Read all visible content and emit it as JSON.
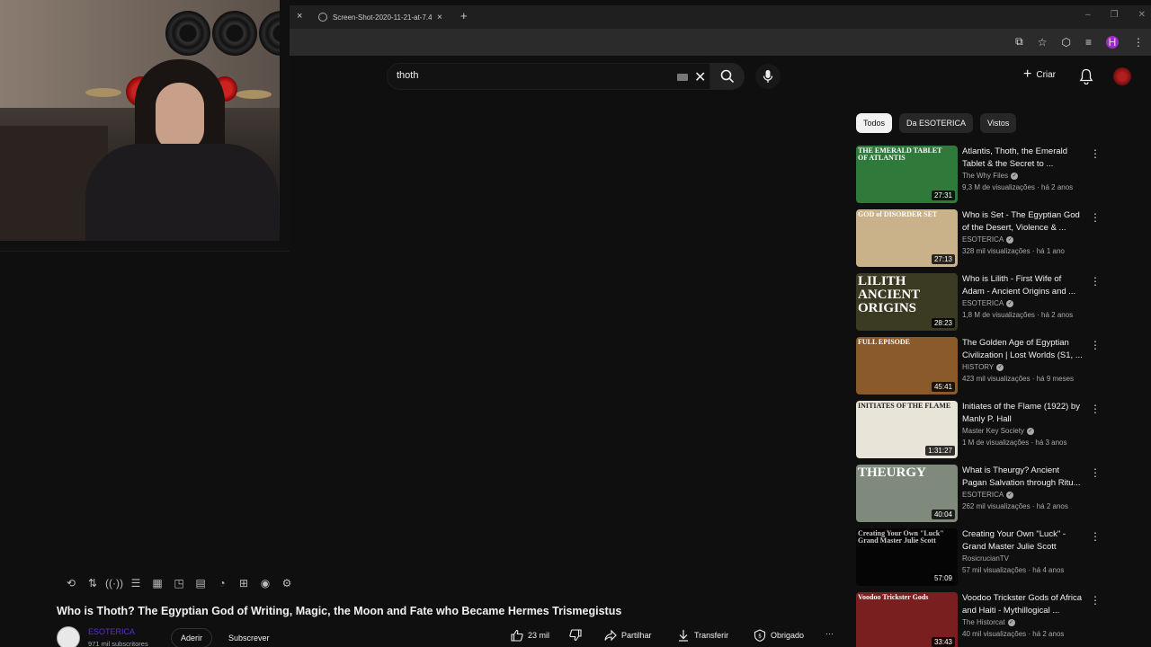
{
  "browser": {
    "tab_title": "Screen-Shot-2020-11-21-at-7.4",
    "new_tab": "+",
    "tab_close": "×",
    "prev_tab_close": "×",
    "window_controls": [
      "–",
      "❐",
      "✕"
    ],
    "profile_initial": "H"
  },
  "header": {
    "search_value": "thoth",
    "create_label": "Criar"
  },
  "chips": [
    "Todos",
    "Da ESOTERICA",
    "Vistos"
  ],
  "recommendations": [
    {
      "title": "Atlantis, Thoth, the Emerald Tablet & the Secret to ...",
      "channel": "The Why Files",
      "verified": true,
      "stats": "9,3 M de visualizações · há 2 anos",
      "duration": "27:31",
      "thumb_text": "THE EMERALD TABLET OF ATLANTIS",
      "thumb_color": "#2f7a3a"
    },
    {
      "title": "Who is Set - The Egyptian God of the Desert, Violence & ...",
      "channel": "ESOTERICA",
      "verified": true,
      "stats": "328 mil visualizações · há 1 ano",
      "duration": "27:13",
      "thumb_text": "GOD of DISORDER SET",
      "thumb_color": "#c9b28a"
    },
    {
      "title": "Who is Lilith - First Wife of Adam - Ancient Origins and ...",
      "channel": "ESOTERICA",
      "verified": true,
      "stats": "1,8 M de visualizações · há 2 anos",
      "duration": "28:23",
      "thumb_text": "LILITH ANCIENT ORIGINS",
      "thumb_color": "#3b3a22"
    },
    {
      "title": "The Golden Age of Egyptian Civilization | Lost Worlds (S1, ...",
      "channel": "HISTORY",
      "verified": true,
      "stats": "423 mil visualizações · há 9 meses",
      "duration": "45:41",
      "thumb_text": "FULL EPISODE",
      "thumb_color": "#8a5a2b"
    },
    {
      "title": "Initiates of the Flame (1922) by Manly P. Hall",
      "channel": "Master Key Society",
      "verified": true,
      "stats": "1 M de visualizações · há 3 anos",
      "duration": "1:31:27",
      "thumb_text": "INITIATES OF THE FLAME",
      "thumb_color": "#e8e4d8"
    },
    {
      "title": "What is Theurgy? Ancient Pagan Salvation through Ritu...",
      "channel": "ESOTERICA",
      "verified": true,
      "stats": "262 mil visualizações · há 2 anos",
      "duration": "40:04",
      "thumb_text": "THEURGY",
      "thumb_color": "#7f8a7d"
    },
    {
      "title": "Creating Your Own \"Luck\" - Grand Master Julie Scott",
      "channel": "RosicrucianTV",
      "verified": false,
      "stats": "57 mil visualizações · há 4 anos",
      "duration": "57:09",
      "thumb_text": "Creating Your Own \"Luck\" Grand Master Julie Scott",
      "thumb_color": "#050505"
    },
    {
      "title": "Voodoo Trickster Gods of Africa and Haiti - Mythillogical ...",
      "channel": "The Historcat",
      "verified": true,
      "stats": "40 mil visualizações · há 2 anos",
      "duration": "33:43",
      "thumb_text": "Voodoo Trickster Gods",
      "thumb_color": "#7a1f1f"
    }
  ],
  "video": {
    "title": "Who is Thoth? The Egyptian God of Writing, Magic, the Moon and Fate who Became Hermes Trismegistus",
    "channel": "ESOTERICA",
    "subscribers": "971 mil subscritores",
    "join_label": "Aderir",
    "subscribe_label": "Subscrever",
    "likes": "23 mil",
    "share_label": "Partilhar",
    "download_label": "Transferir",
    "thanks_label": "Obrigado",
    "more_label": "···"
  },
  "icons": [
    "loop-icon",
    "sort-icon",
    "broadcast-icon",
    "playlist-icon",
    "clapper-icon",
    "pip-icon",
    "subtitle-icon",
    "speed-icon",
    "clip-icon",
    "screenshot-icon",
    "settings-icon"
  ],
  "colors": {
    "background": "#0f0f0f",
    "channel_link": "#5a2dd8",
    "accent_red": "#cc0000"
  }
}
